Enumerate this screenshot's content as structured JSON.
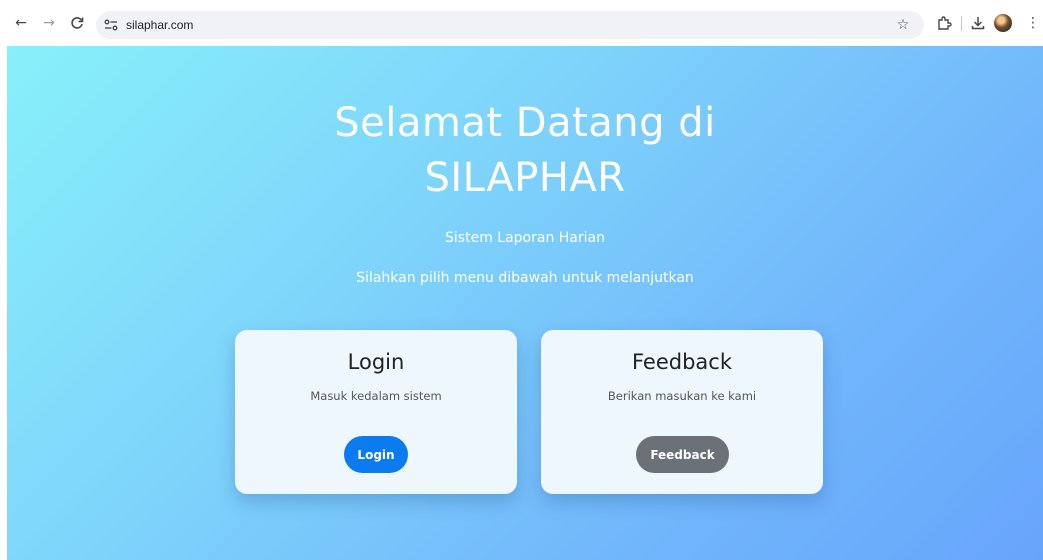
{
  "browser": {
    "url": "silaphar.com",
    "back_icon": "←",
    "forward_icon": "→",
    "reload_icon": "C",
    "star_icon": "☆",
    "extensions_icon": "⧉",
    "download_icon": "⤓",
    "menu_icon": "⋮"
  },
  "hero": {
    "title_line1": "Selamat Datang di",
    "title_line2": "SILAPHAR",
    "subtitle": "Sistem Laporan Harian",
    "description": "Silahkan pilih menu dibawah untuk melanjutkan"
  },
  "cards": [
    {
      "title": "Login",
      "text": "Masuk kedalam sistem",
      "button_label": "Login",
      "button_color": "#0d7bf0"
    },
    {
      "title": "Feedback",
      "text": "Berikan masukan ke kami",
      "button_label": "Feedback",
      "button_color": "#6b7177"
    }
  ],
  "colors": {
    "gradient_start": "#88f0fa",
    "gradient_end": "#67a5fb",
    "card_bg": "#eef7fd"
  }
}
